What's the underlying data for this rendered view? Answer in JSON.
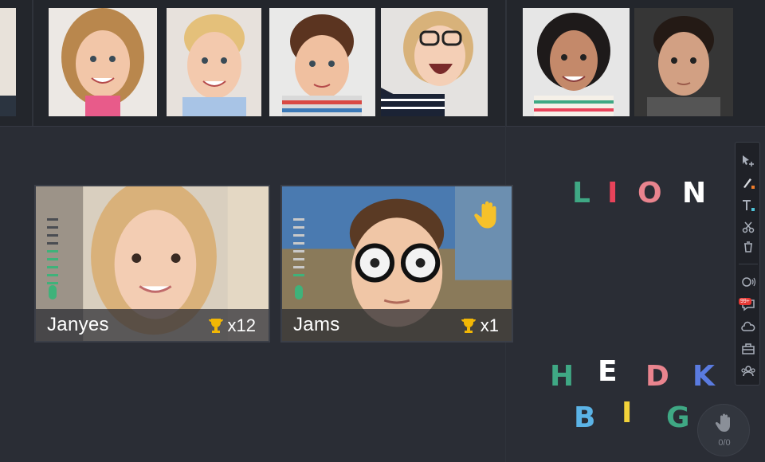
{
  "students": [
    {
      "name": "Janyes",
      "trophies": "x12"
    },
    {
      "name": "Jams",
      "trophies": "x1"
    }
  ],
  "word_letters": [
    "L",
    "I",
    "O",
    "N"
  ],
  "scattered_letters": [
    "H",
    "E",
    "D",
    "K",
    "B",
    "I",
    "G"
  ],
  "raise_hand": {
    "count": "0/0"
  },
  "toolbar": {
    "message_badge": "99+"
  },
  "colors": {
    "green": "#3fa884",
    "red": "#e8435a",
    "pink": "#e9848e",
    "blue": "#5a7be0",
    "lightblue": "#5bb3e6",
    "yellow": "#f2d23a",
    "trophy": "#f2b705"
  }
}
